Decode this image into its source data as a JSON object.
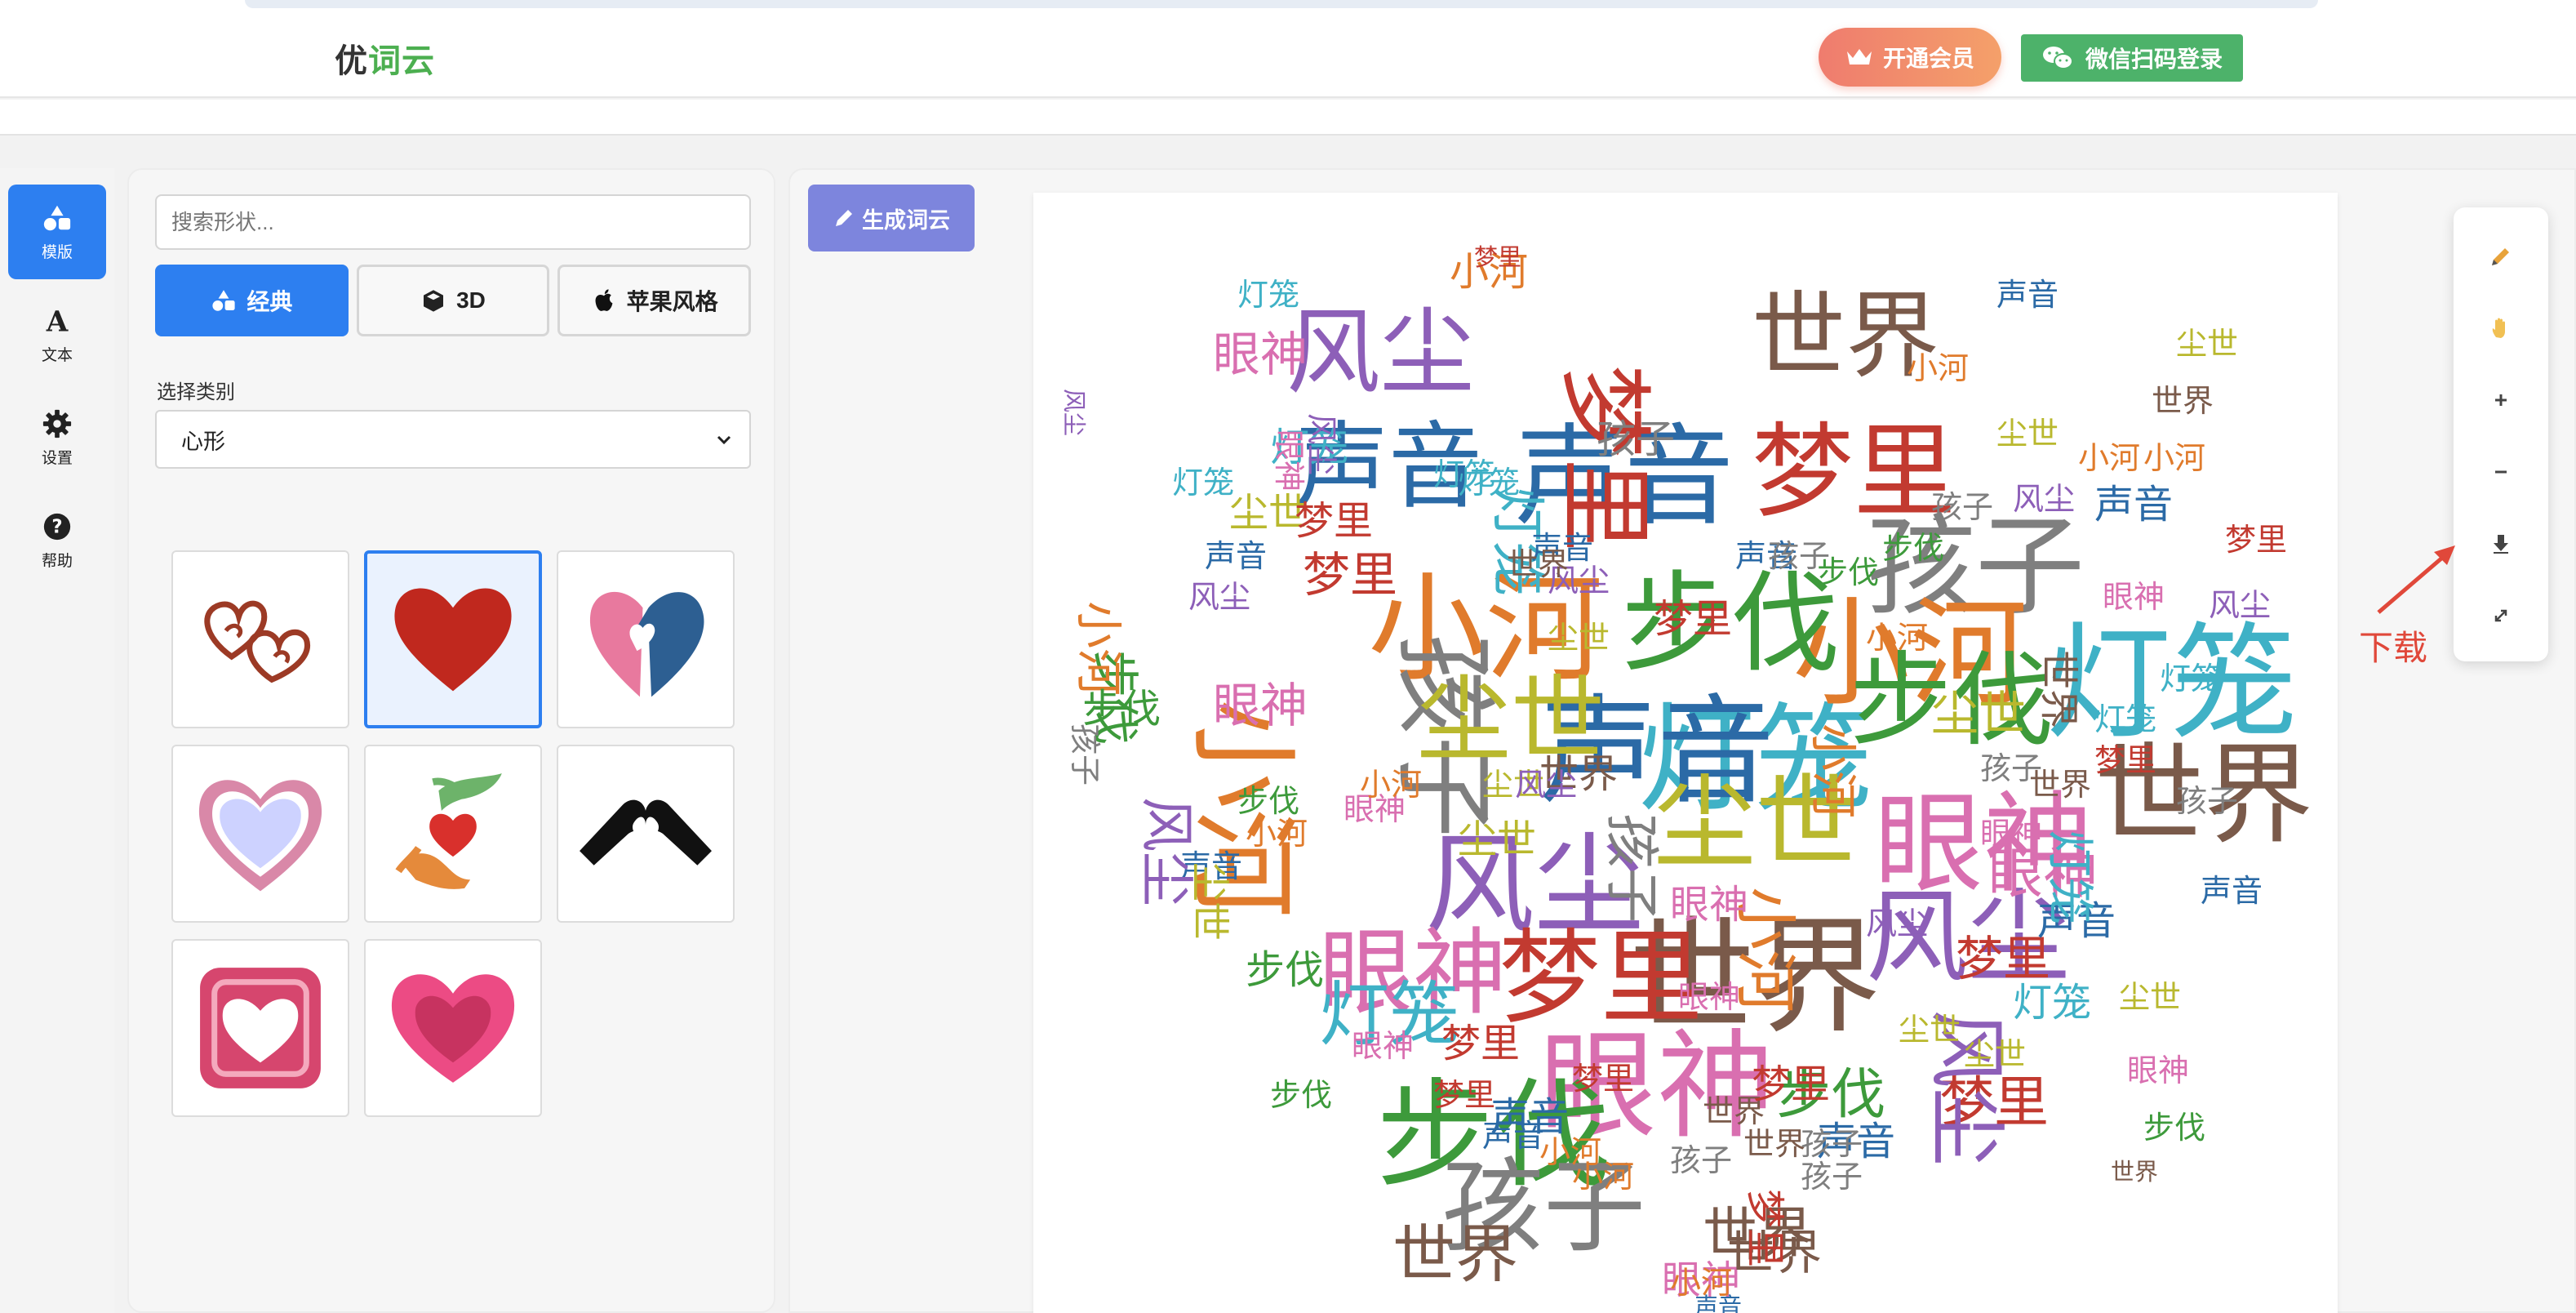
{
  "app": {
    "logo_prefix": "优",
    "logo_accent": "词云"
  },
  "header": {
    "vip_label": "开通会员",
    "wechat_label": "微信扫码登录"
  },
  "rail": {
    "items": [
      {
        "label": "模版",
        "icon": "shapes-icon",
        "active": true
      },
      {
        "label": "文本",
        "icon": "text-icon",
        "active": false
      },
      {
        "label": "设置",
        "icon": "gear-icon",
        "active": false
      },
      {
        "label": "帮助",
        "icon": "help-icon",
        "active": false
      }
    ]
  },
  "panel": {
    "search_placeholder": "搜索形状...",
    "tabs": [
      {
        "label": "经典",
        "icon": "shapes-icon",
        "active": true
      },
      {
        "label": "3D",
        "icon": "cube-icon",
        "active": false
      },
      {
        "label": "苹果风格",
        "icon": "apple-icon",
        "active": false
      }
    ],
    "category_label": "选择类别",
    "category_value": "心形",
    "shapes": [
      {
        "name": "double-hearts-icon",
        "selected": false
      },
      {
        "name": "red-heart-icon",
        "selected": true
      },
      {
        "name": "split-heart-icon",
        "selected": false
      },
      {
        "name": "outlined-heart-icon",
        "selected": false
      },
      {
        "name": "hands-heart-icon",
        "selected": false
      },
      {
        "name": "hand-heart-gesture-icon",
        "selected": false
      },
      {
        "name": "framed-heart-icon",
        "selected": false
      },
      {
        "name": "layered-heart-icon",
        "selected": false
      }
    ]
  },
  "main": {
    "generate_label": "生成词云"
  },
  "wordcloud": {
    "words": [
      "风尘",
      "声音",
      "小河",
      "孩子",
      "世界",
      "梦里",
      "步伐",
      "尘世",
      "灯笼",
      "眼神"
    ],
    "colors": [
      "#2b6aa6",
      "#e07b2c",
      "#3d9a3b",
      "#c23a30",
      "#8d5fb8",
      "#7a5a4a",
      "#d96fb0",
      "#7f7f7f",
      "#b9b82e",
      "#3fb1c6"
    ]
  },
  "toolbar": {
    "tools": [
      "pencil-icon",
      "hand-icon",
      "zoom-in-icon",
      "zoom-out-icon",
      "download-icon",
      "fullscreen-icon"
    ]
  },
  "annotation": {
    "download_label": "下载",
    "color": "#e0483a"
  }
}
